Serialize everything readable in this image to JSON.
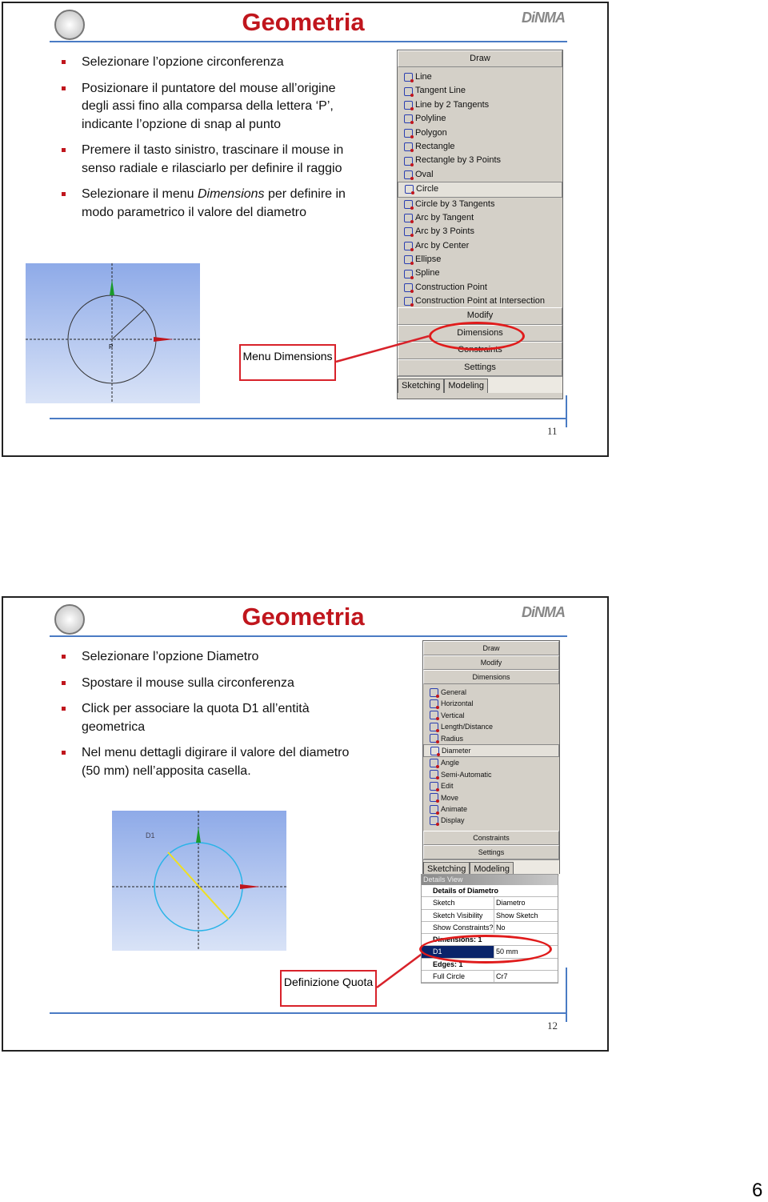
{
  "slides": [
    {
      "title": "Geometria",
      "page": "11",
      "bullets": [
        "Selezionare l’opzione circonferenza",
        "Posizionare il puntatore del mouse all’origine degli assi fino alla comparsa della lettera ‘P’, indicante l’opzione di snap al punto",
        "Premere il tasto sinistro, trascinare il mouse in senso radiale e rilasciarlo per definire il raggio"
      ],
      "bullet4": {
        "pre": "Selezionare il menu ",
        "em": "Dimensions",
        "post": " per definire in modo parametrico il valore del diametro"
      },
      "canvas_label": "P",
      "panel": {
        "header": "Draw",
        "items": [
          "Line",
          "Tangent Line",
          "Line by 2 Tangents",
          "Polyline",
          "Polygon",
          "Rectangle",
          "Rectangle by 3 Points",
          "Oval",
          "Circle",
          "Circle by 3 Tangents",
          "Arc by Tangent",
          "Arc by 3 Points",
          "Arc by Center",
          "Ellipse",
          "Spline",
          "Construction Point",
          "Construction Point at Intersection"
        ],
        "selected": "Circle",
        "footers": [
          "Modify",
          "Dimensions",
          "Constraints",
          "Settings"
        ],
        "tabs": [
          "Sketching",
          "Modeling"
        ]
      },
      "callout": "Menu Dimensions"
    },
    {
      "title": "Geometria",
      "page": "12",
      "bullets": [
        "Selezionare l’opzione Diametro",
        "Spostare il mouse sulla circonferenza",
        "Click per associare la quota D1 all’entità geometrica",
        "Nel menu dettagli digirare il valore del diametro (50 mm) nell’apposita casella."
      ],
      "canvas_label": "D1",
      "panel": {
        "headers": [
          "Draw",
          "Modify",
          "Dimensions"
        ],
        "items": [
          "General",
          "Horizontal",
          "Vertical",
          "Length/Distance",
          "Radius",
          "Diameter",
          "Angle",
          "Semi-Automatic",
          "Edit",
          "Move",
          "Animate",
          "Display"
        ],
        "selected": "Diameter",
        "footers": [
          "Constraints",
          "Settings"
        ],
        "tabs": [
          "Sketching",
          "Modeling"
        ]
      },
      "details": {
        "title": "Details View",
        "rows": [
          {
            "k": "Details of Diametro",
            "group": true
          },
          {
            "k": "Sketch",
            "v": "Diametro"
          },
          {
            "k": "Sketch Visibility",
            "v": "Show Sketch"
          },
          {
            "k": "Show Constraints?",
            "v": "No"
          },
          {
            "k": "Dimensions: 1",
            "group": true
          },
          {
            "k": "D1",
            "v": "50 mm",
            "highlight": true
          },
          {
            "k": "Edges: 1",
            "group": true
          },
          {
            "k": "Full Circle",
            "v": "Cr7"
          }
        ]
      },
      "callout": "Definizione Quota"
    }
  ],
  "page_number": "6",
  "colors": {
    "title": "#c0161d",
    "rule": "#4a7bc4",
    "callout": "#d8222a"
  }
}
